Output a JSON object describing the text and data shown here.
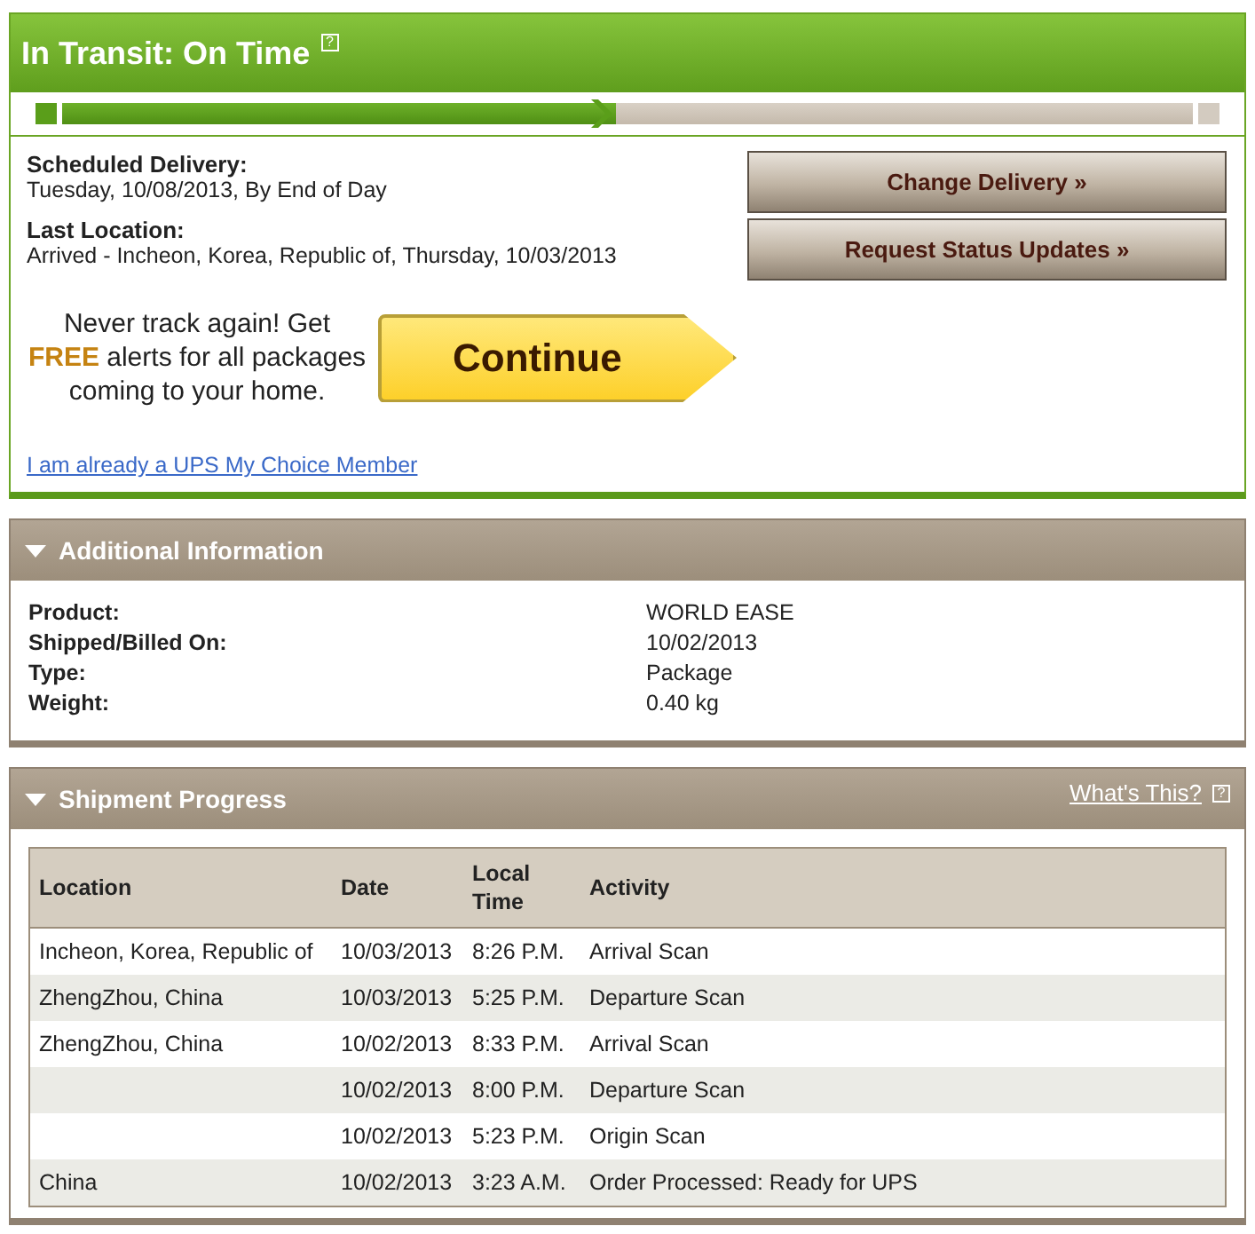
{
  "status": {
    "title": "In Transit: On Time",
    "help": "?",
    "progress": {
      "level": 0.49
    },
    "scheduled_label": "Scheduled Delivery:",
    "scheduled_value": "Tuesday, 10/08/2013, By End of Day",
    "last_label": "Last Location:",
    "last_value": "Arrived - Incheon, Korea, Republic of, Thursday, 10/03/2013",
    "buttons": [
      "Change Delivery »",
      "Request Status Updates »"
    ],
    "promo": "Never track again! Get **FREE** alerts for all packages coming to your home.",
    "continue": "Continue",
    "member_link": "I am already a UPS My Choice Member"
  },
  "additional": {
    "title": "Additional Information",
    "expanded": true,
    "rows": [
      {
        "label": "Product:",
        "value": "WORLD EASE"
      },
      {
        "label": "Shipped/Billed On:",
        "value": "10/02/2013"
      },
      {
        "label": "Type:",
        "value": "Package"
      },
      {
        "label": "Weight:",
        "value": "0.40 kg"
      }
    ]
  },
  "progress": {
    "title": "Shipment Progress",
    "expanded": true,
    "whats_this": "What's This?",
    "help": "?",
    "columns": [
      "Location",
      "Date",
      "Local Time",
      "Activity"
    ],
    "rows": [
      {
        "location": "Incheon, Korea, Republic of",
        "date": "10/03/2013",
        "time": "8:26 P.M.",
        "activity": "Arrival Scan"
      },
      {
        "location": "ZhengZhou, China",
        "date": "10/03/2013",
        "time": "5:25 P.M.",
        "activity": "Departure Scan"
      },
      {
        "location": "ZhengZhou, China",
        "date": "10/02/2013",
        "time": "8:33 P.M.",
        "activity": "Arrival Scan"
      },
      {
        "date": "10/02/2013",
        "time": "8:00 P.M.",
        "activity": "Departure Scan"
      },
      {
        "date": "10/02/2013",
        "time": "5:23 P.M.",
        "activity": "Origin Scan"
      },
      {
        "location": "China",
        "date": "10/02/2013",
        "time": "3:23 A.M.",
        "activity": "Order Processed: Ready for UPS"
      }
    ]
  }
}
